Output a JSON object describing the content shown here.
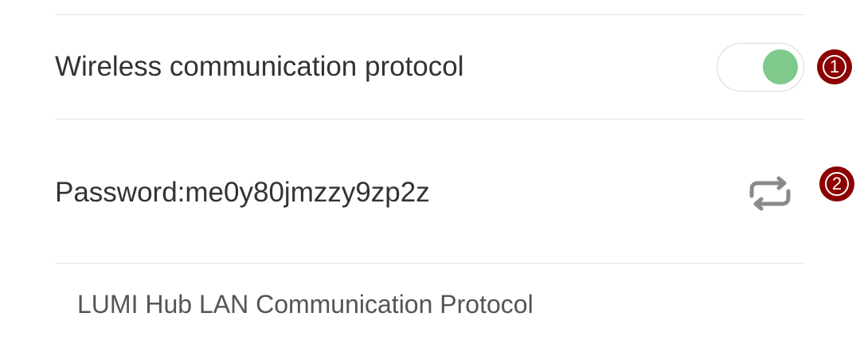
{
  "settings": {
    "wireless_row": {
      "label": "Wireless communication protocol",
      "toggle_on": true
    },
    "password_row": {
      "label": "Password:me0y80jmzzy9zp2z",
      "refresh_icon": "refresh-icon"
    },
    "footer": {
      "text": "LUMI Hub LAN Communication Protocol"
    }
  },
  "annotations": [
    {
      "number": "1"
    },
    {
      "number": "2"
    }
  ],
  "colors": {
    "toggle_knob": "#7ec98b",
    "badge": "#8b0000",
    "icon": "#8a8a8a"
  }
}
